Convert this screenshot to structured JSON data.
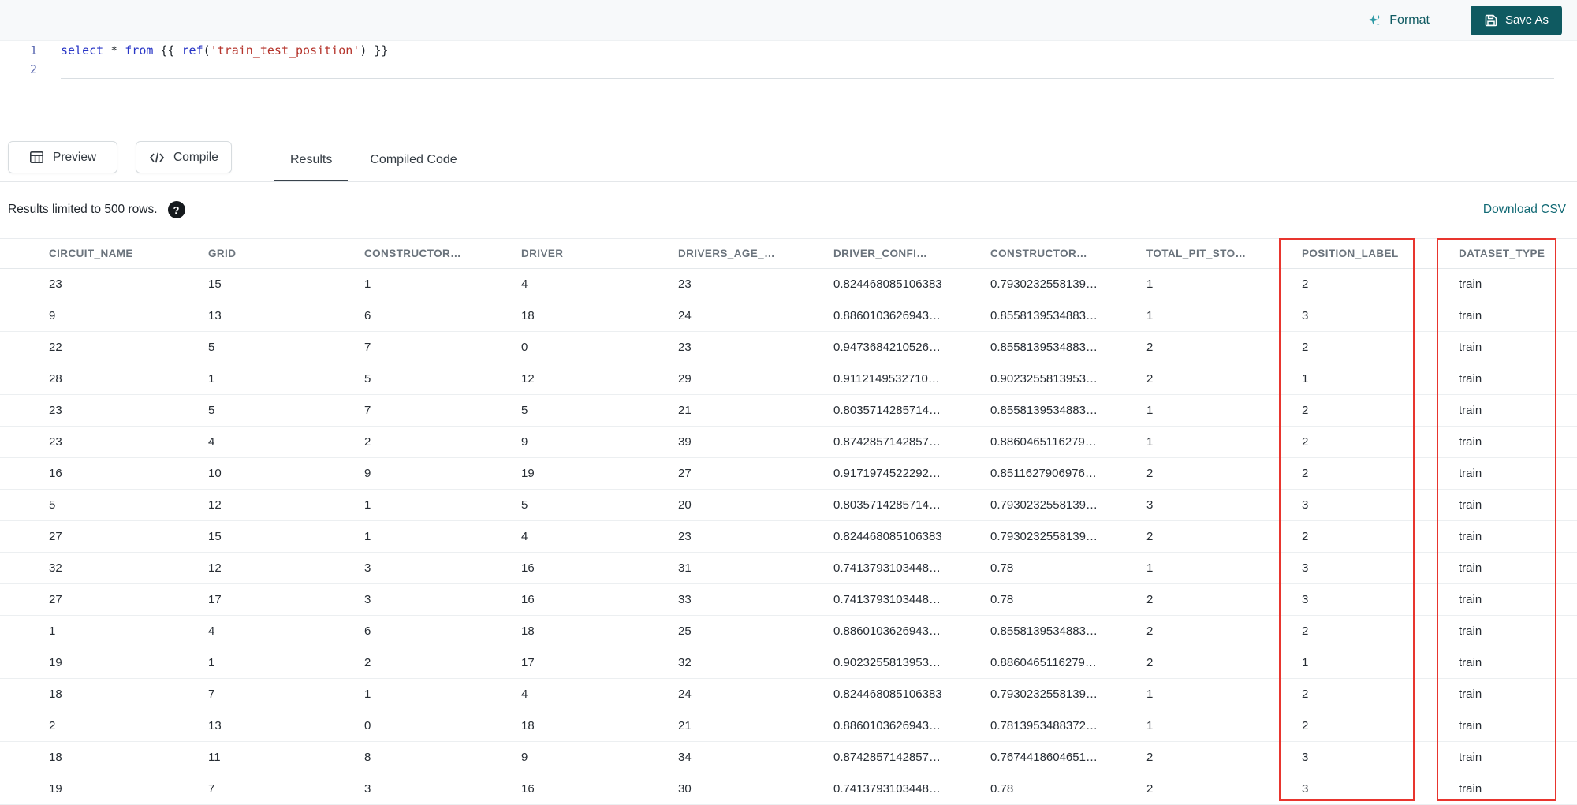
{
  "colors": {
    "accent_teal": "#0f5a61",
    "link_teal": "#116974",
    "highlight_red": "#e8352e",
    "keyword_blue": "#2936c6",
    "string_red": "#b5342c"
  },
  "toolbar": {
    "format_label": "Format",
    "save_as_label": "Save As"
  },
  "editor": {
    "lines": [
      {
        "number": "1",
        "tokens": [
          [
            "kw",
            "select"
          ],
          [
            "pl",
            " * "
          ],
          [
            "kw",
            "from"
          ],
          [
            "pl",
            " {{ "
          ],
          [
            "fn",
            "ref"
          ],
          [
            "pl",
            "("
          ],
          [
            "str",
            "'train_test_position'"
          ],
          [
            "pl",
            ") }}"
          ]
        ]
      },
      {
        "number": "2",
        "tokens": []
      }
    ]
  },
  "actions": {
    "preview_label": "Preview",
    "compile_label": "Compile"
  },
  "tabs": [
    {
      "label": "Results",
      "active": true
    },
    {
      "label": "Compiled Code",
      "active": false
    }
  ],
  "results_bar": {
    "limit_text": "Results limited to 500 rows.",
    "help_icon": "?",
    "download_label": "Download CSV"
  },
  "table": {
    "columns": [
      "CIRCUIT_NAME",
      "GRID",
      "CONSTRUCTOR…",
      "DRIVER",
      "DRIVERS_AGE_…",
      "DRIVER_CONFI…",
      "CONSTRUCTOR…",
      "TOTAL_PIT_STO…",
      "POSITION_LABEL",
      "DATASET_TYPE"
    ],
    "highlighted_columns": [
      "POSITION_LABEL",
      "DATASET_TYPE"
    ],
    "rows": [
      [
        "23",
        "15",
        "1",
        "4",
        "23",
        "0.824468085106383",
        "0.7930232558139…",
        "1",
        "2",
        "train"
      ],
      [
        "9",
        "13",
        "6",
        "18",
        "24",
        "0.8860103626943…",
        "0.8558139534883…",
        "1",
        "3",
        "train"
      ],
      [
        "22",
        "5",
        "7",
        "0",
        "23",
        "0.9473684210526…",
        "0.8558139534883…",
        "2",
        "2",
        "train"
      ],
      [
        "28",
        "1",
        "5",
        "12",
        "29",
        "0.9112149532710…",
        "0.9023255813953…",
        "2",
        "1",
        "train"
      ],
      [
        "23",
        "5",
        "7",
        "5",
        "21",
        "0.8035714285714…",
        "0.8558139534883…",
        "1",
        "2",
        "train"
      ],
      [
        "23",
        "4",
        "2",
        "9",
        "39",
        "0.8742857142857…",
        "0.8860465116279…",
        "1",
        "2",
        "train"
      ],
      [
        "16",
        "10",
        "9",
        "19",
        "27",
        "0.9171974522292…",
        "0.8511627906976…",
        "2",
        "2",
        "train"
      ],
      [
        "5",
        "12",
        "1",
        "5",
        "20",
        "0.8035714285714…",
        "0.7930232558139…",
        "3",
        "3",
        "train"
      ],
      [
        "27",
        "15",
        "1",
        "4",
        "23",
        "0.824468085106383",
        "0.7930232558139…",
        "2",
        "2",
        "train"
      ],
      [
        "32",
        "12",
        "3",
        "16",
        "31",
        "0.7413793103448…",
        "0.78",
        "1",
        "3",
        "train"
      ],
      [
        "27",
        "17",
        "3",
        "16",
        "33",
        "0.7413793103448…",
        "0.78",
        "2",
        "3",
        "train"
      ],
      [
        "1",
        "4",
        "6",
        "18",
        "25",
        "0.8860103626943…",
        "0.8558139534883…",
        "2",
        "2",
        "train"
      ],
      [
        "19",
        "1",
        "2",
        "17",
        "32",
        "0.9023255813953…",
        "0.8860465116279…",
        "2",
        "1",
        "train"
      ],
      [
        "18",
        "7",
        "1",
        "4",
        "24",
        "0.824468085106383",
        "0.7930232558139…",
        "1",
        "2",
        "train"
      ],
      [
        "2",
        "13",
        "0",
        "18",
        "21",
        "0.8860103626943…",
        "0.7813953488372…",
        "1",
        "2",
        "train"
      ],
      [
        "18",
        "11",
        "8",
        "9",
        "34",
        "0.8742857142857…",
        "0.7674418604651…",
        "2",
        "3",
        "train"
      ],
      [
        "19",
        "7",
        "3",
        "16",
        "30",
        "0.7413793103448…",
        "0.78",
        "2",
        "3",
        "train"
      ]
    ]
  }
}
